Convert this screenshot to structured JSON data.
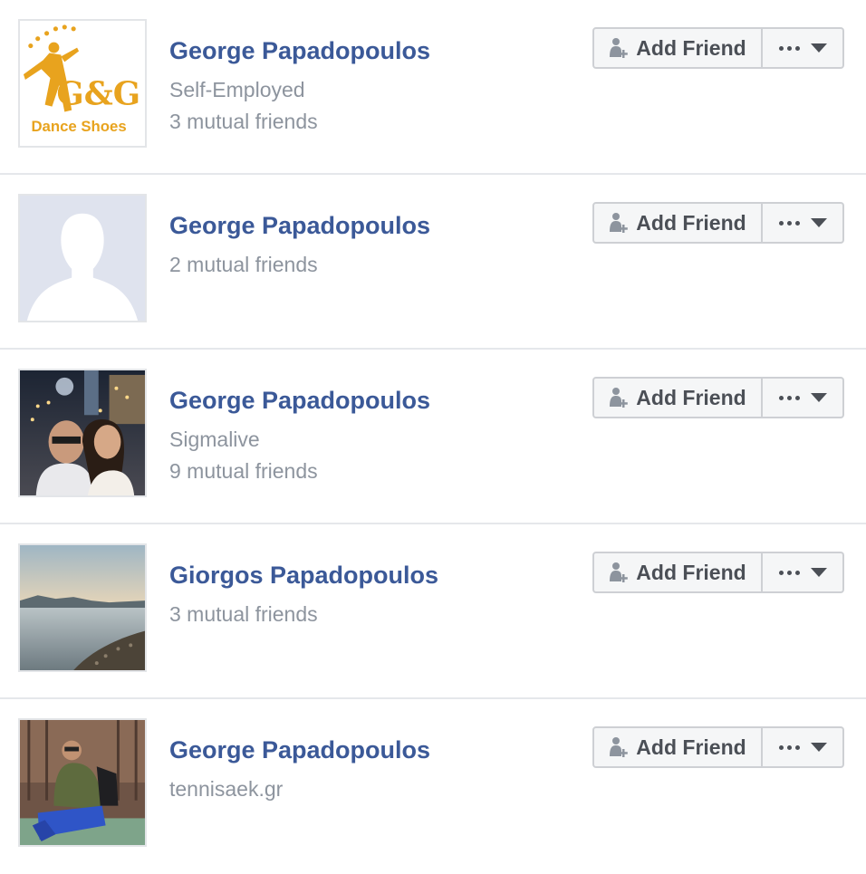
{
  "people": [
    {
      "name": "George Papadopoulos",
      "details": [
        "Self-Employed",
        "3 mutual friends"
      ],
      "avatar": "gg-dance-shoes-logo",
      "logo_text_top": "G&G",
      "logo_text_bottom": "Dance Shoes"
    },
    {
      "name": "George Papadopoulos",
      "details": [
        "2 mutual friends"
      ],
      "avatar": "default-silhouette"
    },
    {
      "name": "George Papadopoulos",
      "details": [
        "Sigmalive",
        "9 mutual friends"
      ],
      "avatar": "couple-city-night-photo"
    },
    {
      "name": "Giorgos Papadopoulos",
      "details": [
        "3 mutual friends"
      ],
      "avatar": "lake-landscape-photo"
    },
    {
      "name": "George Papadopoulos",
      "details": [
        "tennisaek.gr"
      ],
      "avatar": "man-sitting-outdoors-photo"
    }
  ],
  "labels": {
    "add_friend": "Add Friend"
  },
  "colors": {
    "name_link": "#3b5998",
    "secondary_text": "#8d949e",
    "button_bg": "#f5f6f7",
    "button_border": "#ced0d4",
    "logo_gold": "#e8a31e"
  }
}
